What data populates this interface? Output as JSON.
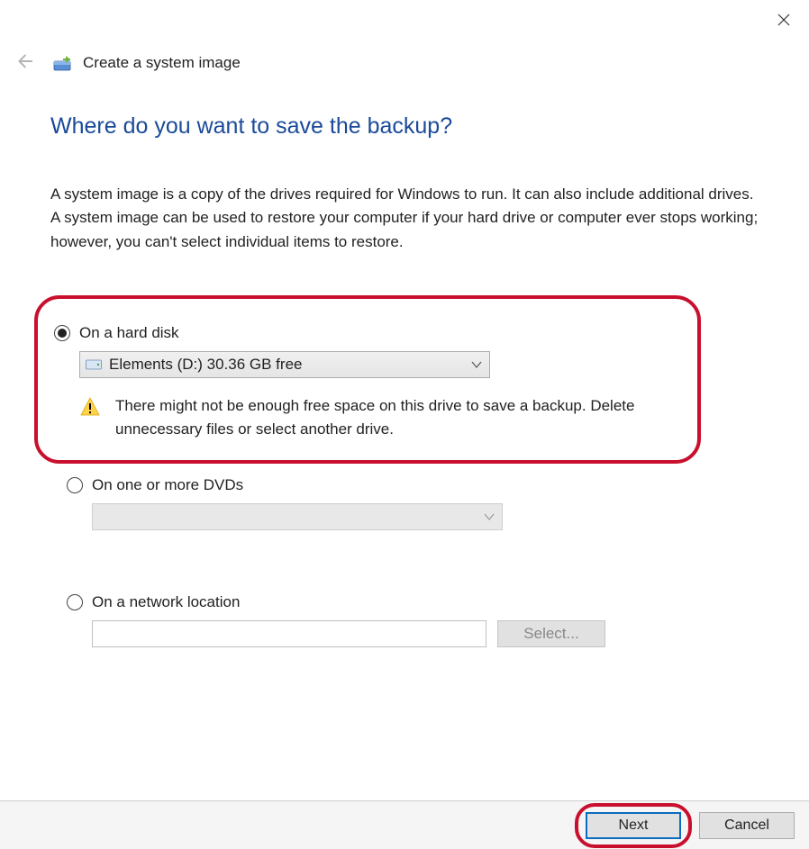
{
  "header": {
    "wizard_title": "Create a system image"
  },
  "main": {
    "question": "Where do you want to save the backup?",
    "description": "A system image is a copy of the drives required for Windows to run. It can also include additional drives. A system image can be used to restore your computer if your hard drive or computer ever stops working; however, you can't select individual items to restore."
  },
  "options": {
    "hard_disk": {
      "label": "On a hard disk",
      "selected_drive": "Elements (D:)  30.36 GB free",
      "warning": "There might not be enough free space on this drive to save a backup. Delete unnecessary files or select another drive."
    },
    "dvd": {
      "label": "On one or more DVDs",
      "selected": ""
    },
    "network": {
      "label": "On a network location",
      "value": "",
      "select_button": "Select..."
    }
  },
  "footer": {
    "next": "Next",
    "cancel": "Cancel"
  },
  "icons": {
    "close": "close-icon",
    "back": "back-arrow-icon",
    "wizard": "system-image-icon",
    "drive": "hard-drive-icon",
    "chevron": "chevron-down-icon",
    "warning": "warning-triangle-icon"
  }
}
